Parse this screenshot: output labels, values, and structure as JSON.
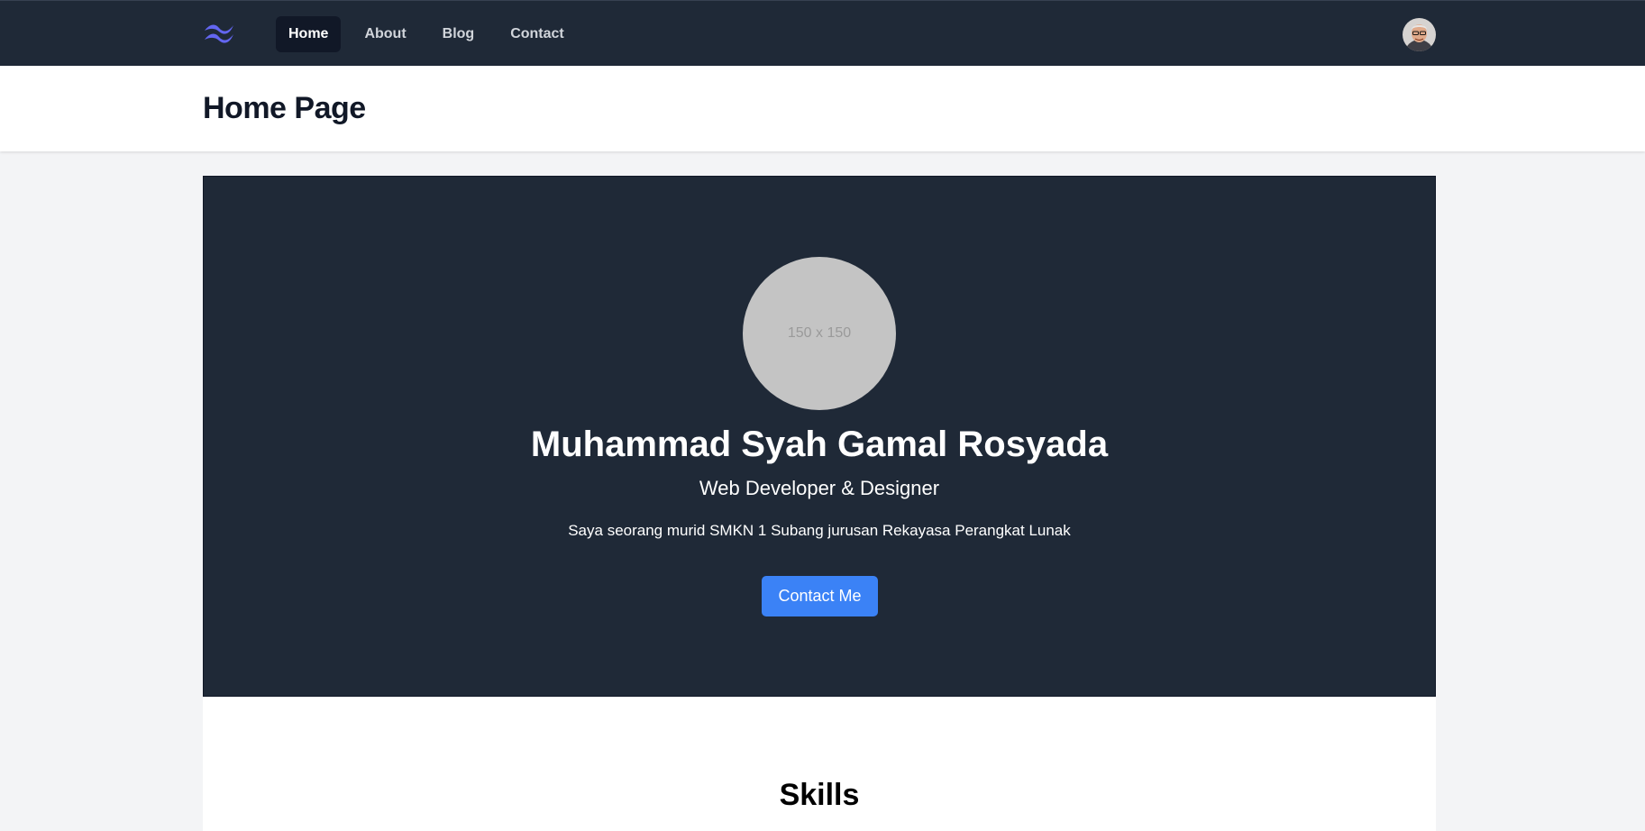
{
  "navbar": {
    "logo_icon": "tailwind-wave-logo",
    "logo_color": "#6366f1",
    "links": [
      {
        "label": "Home",
        "active": true
      },
      {
        "label": "About",
        "active": false
      },
      {
        "label": "Blog",
        "active": false
      },
      {
        "label": "Contact",
        "active": false
      }
    ],
    "avatar_icon": "user-avatar"
  },
  "header": {
    "title": "Home Page"
  },
  "hero": {
    "photo_placeholder": "150 x 150",
    "name": "Muhammad Syah Gamal Rosyada",
    "role": "Web Developer & Designer",
    "description": "Saya seorang murid SMKN 1 Subang jurusan Rekayasa Perangkat Lunak",
    "button_label": "Contact Me",
    "button_color": "#3b82f6",
    "background": "#1f2937"
  },
  "skills": {
    "title": "Skills"
  }
}
